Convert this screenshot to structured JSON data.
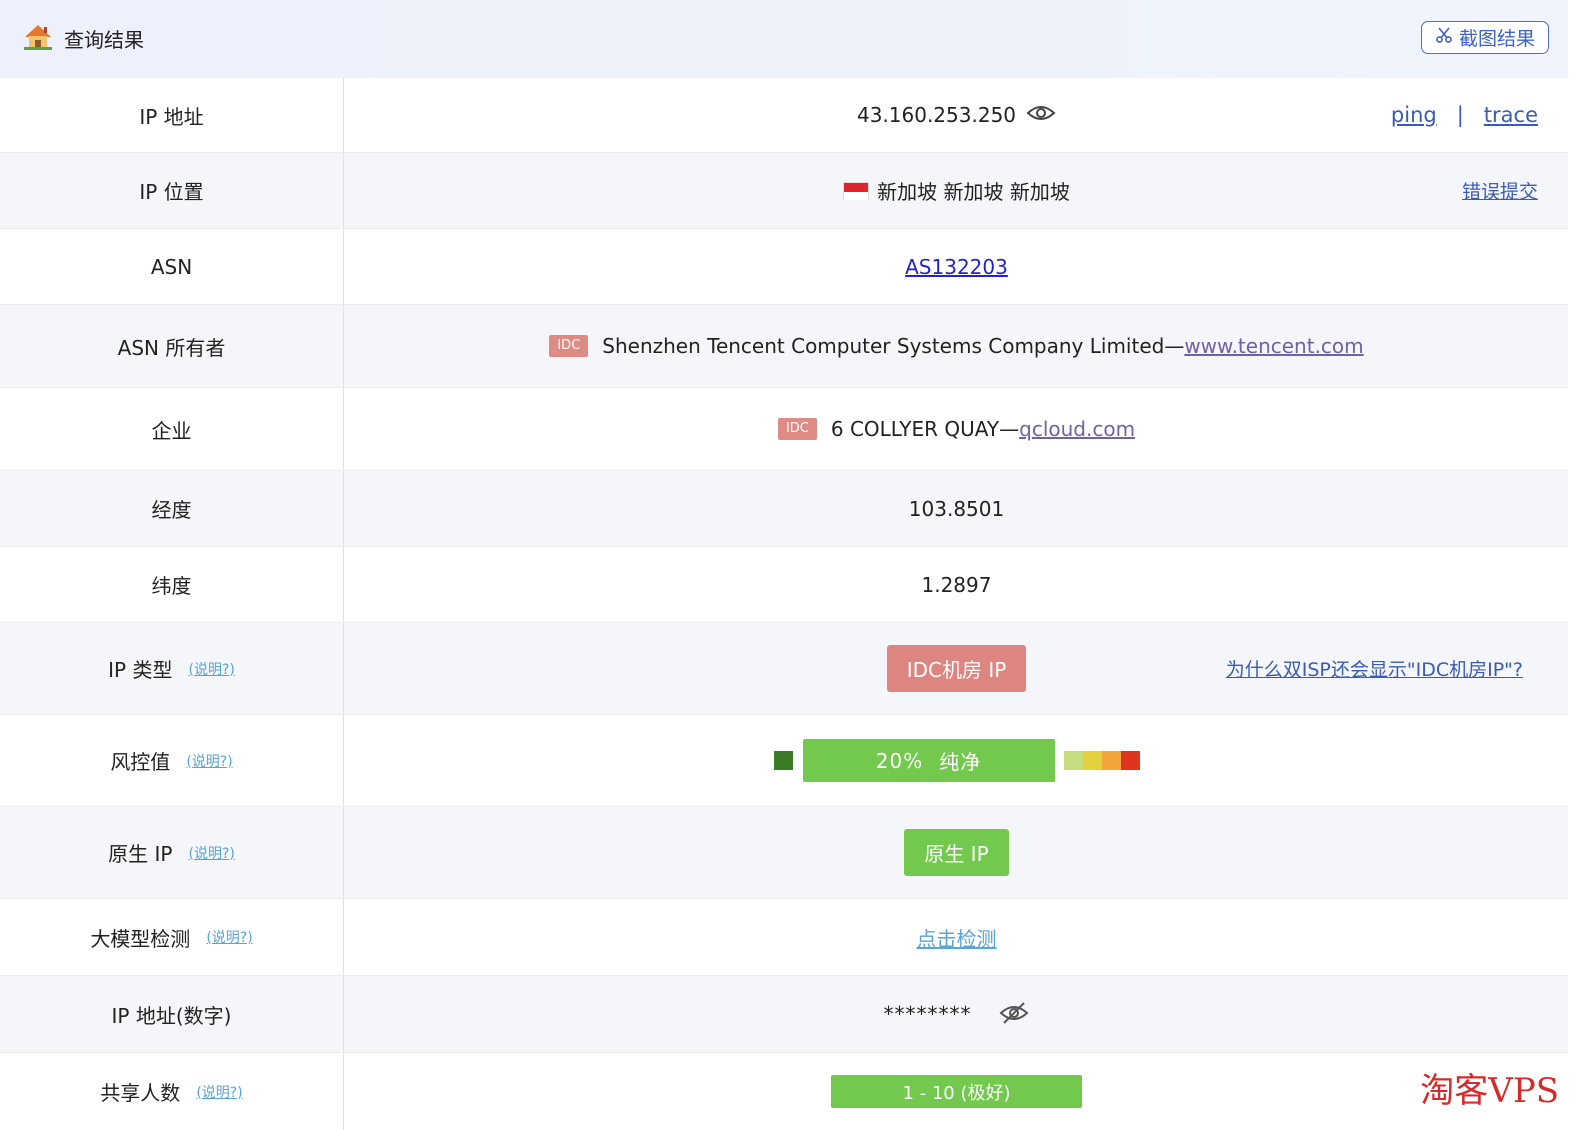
{
  "header": {
    "title": "查询结果",
    "screenshot_button": "截图结果"
  },
  "rows": {
    "ip": {
      "label": "IP 地址",
      "value": "43.160.253.250",
      "ping": "ping",
      "sep": "|",
      "trace": "trace"
    },
    "location": {
      "label": "IP 位置",
      "value": "新加坡 新加坡 新加坡",
      "error_link": "错误提交"
    },
    "asn": {
      "label": "ASN",
      "value": "AS132203"
    },
    "asn_owner": {
      "label": "ASN 所有者",
      "tag": "IDC",
      "value": "Shenzhen Tencent Computer Systems Company Limited—",
      "link": "www.tencent.com"
    },
    "company": {
      "label": "企业",
      "tag": "IDC",
      "value": "6 COLLYER QUAY—",
      "link": "qcloud.com"
    },
    "longitude": {
      "label": "经度",
      "value": "103.8501"
    },
    "latitude": {
      "label": "纬度",
      "value": "1.2897"
    },
    "ip_type": {
      "label": "IP 类型",
      "explain": "(说明?)",
      "badge": "IDC机房 IP",
      "why_link": "为什么双ISP还会显示\"IDC机房IP\"?"
    },
    "risk": {
      "label": "风控值",
      "explain": "(说明?)",
      "percent": "20%",
      "verdict": "纯净",
      "level": 0.2
    },
    "native": {
      "label": "原生 IP",
      "explain": "(说明?)",
      "badge": "原生 IP"
    },
    "llm": {
      "label": "大模型检测",
      "explain": "(说明?)",
      "link": "点击检测"
    },
    "ip_numeric": {
      "label": "IP 地址(数字)",
      "value": "********"
    },
    "shared": {
      "label": "共享人数",
      "explain": "(说明?)",
      "badge": "1 - 10 (极好)"
    }
  },
  "colors": {
    "idc_red": "#dc8581",
    "pure_green": "#73c94e",
    "link_blue": "#3a5bb8",
    "explain_blue": "#59a5d6",
    "risk_scale": [
      "#c6dd7f",
      "#e4cf3c",
      "#f0a63a",
      "#e0341e"
    ]
  },
  "watermark": "淘客VPS"
}
